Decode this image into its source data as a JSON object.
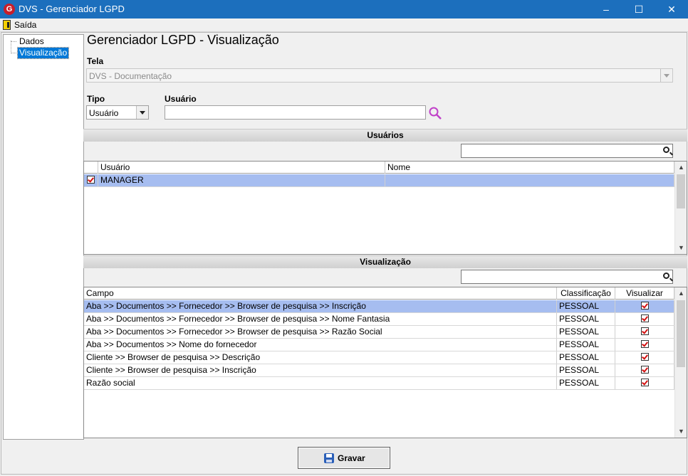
{
  "window": {
    "title": "DVS - Gerenciador LGPD",
    "app_icon_letter": "G",
    "minimize": "–",
    "maximize": "☐",
    "close": "✕"
  },
  "menu": {
    "exit_label": "Saída"
  },
  "tree": {
    "items": [
      "Dados",
      "Visualização"
    ],
    "selected": "Visualização"
  },
  "page_title": "Gerenciador LGPD - Visualização",
  "tela": {
    "label": "Tela",
    "value": "DVS - Documentação"
  },
  "tipo": {
    "label": "Tipo",
    "value": "Usuário"
  },
  "usuario": {
    "label": "Usuário",
    "value": ""
  },
  "usuarios_section": {
    "title": "Usuários",
    "columns": [
      "Usuário",
      "Nome"
    ],
    "rows": [
      {
        "checked": true,
        "usuario": "MANAGER",
        "nome": ""
      }
    ]
  },
  "visualizacao_section": {
    "title": "Visualização",
    "columns": [
      "Campo",
      "Classificação",
      "Visualizar"
    ],
    "rows": [
      {
        "campo": "Aba >> Documentos  >> Fornecedor >> Browser de pesquisa >> Inscrição",
        "classificacao": "PESSOAL",
        "visualizar": true
      },
      {
        "campo": "Aba >> Documentos  >> Fornecedor >> Browser de pesquisa >> Nome Fantasia",
        "classificacao": "PESSOAL",
        "visualizar": true
      },
      {
        "campo": "Aba >> Documentos  >> Fornecedor >> Browser de pesquisa >> Razão Social",
        "classificacao": "PESSOAL",
        "visualizar": true
      },
      {
        "campo": "Aba >> Documentos  >> Nome do fornecedor",
        "classificacao": "PESSOAL",
        "visualizar": true
      },
      {
        "campo": "Cliente >> Browser de pesquisa >> Descrição",
        "classificacao": "PESSOAL",
        "visualizar": true
      },
      {
        "campo": "Cliente >> Browser de pesquisa >> Inscrição",
        "classificacao": "PESSOAL",
        "visualizar": true
      },
      {
        "campo": "Razão social",
        "classificacao": "PESSOAL",
        "visualizar": true
      }
    ]
  },
  "save_button": {
    "label": "Gravar",
    "icon": "floppy-disk-icon"
  }
}
